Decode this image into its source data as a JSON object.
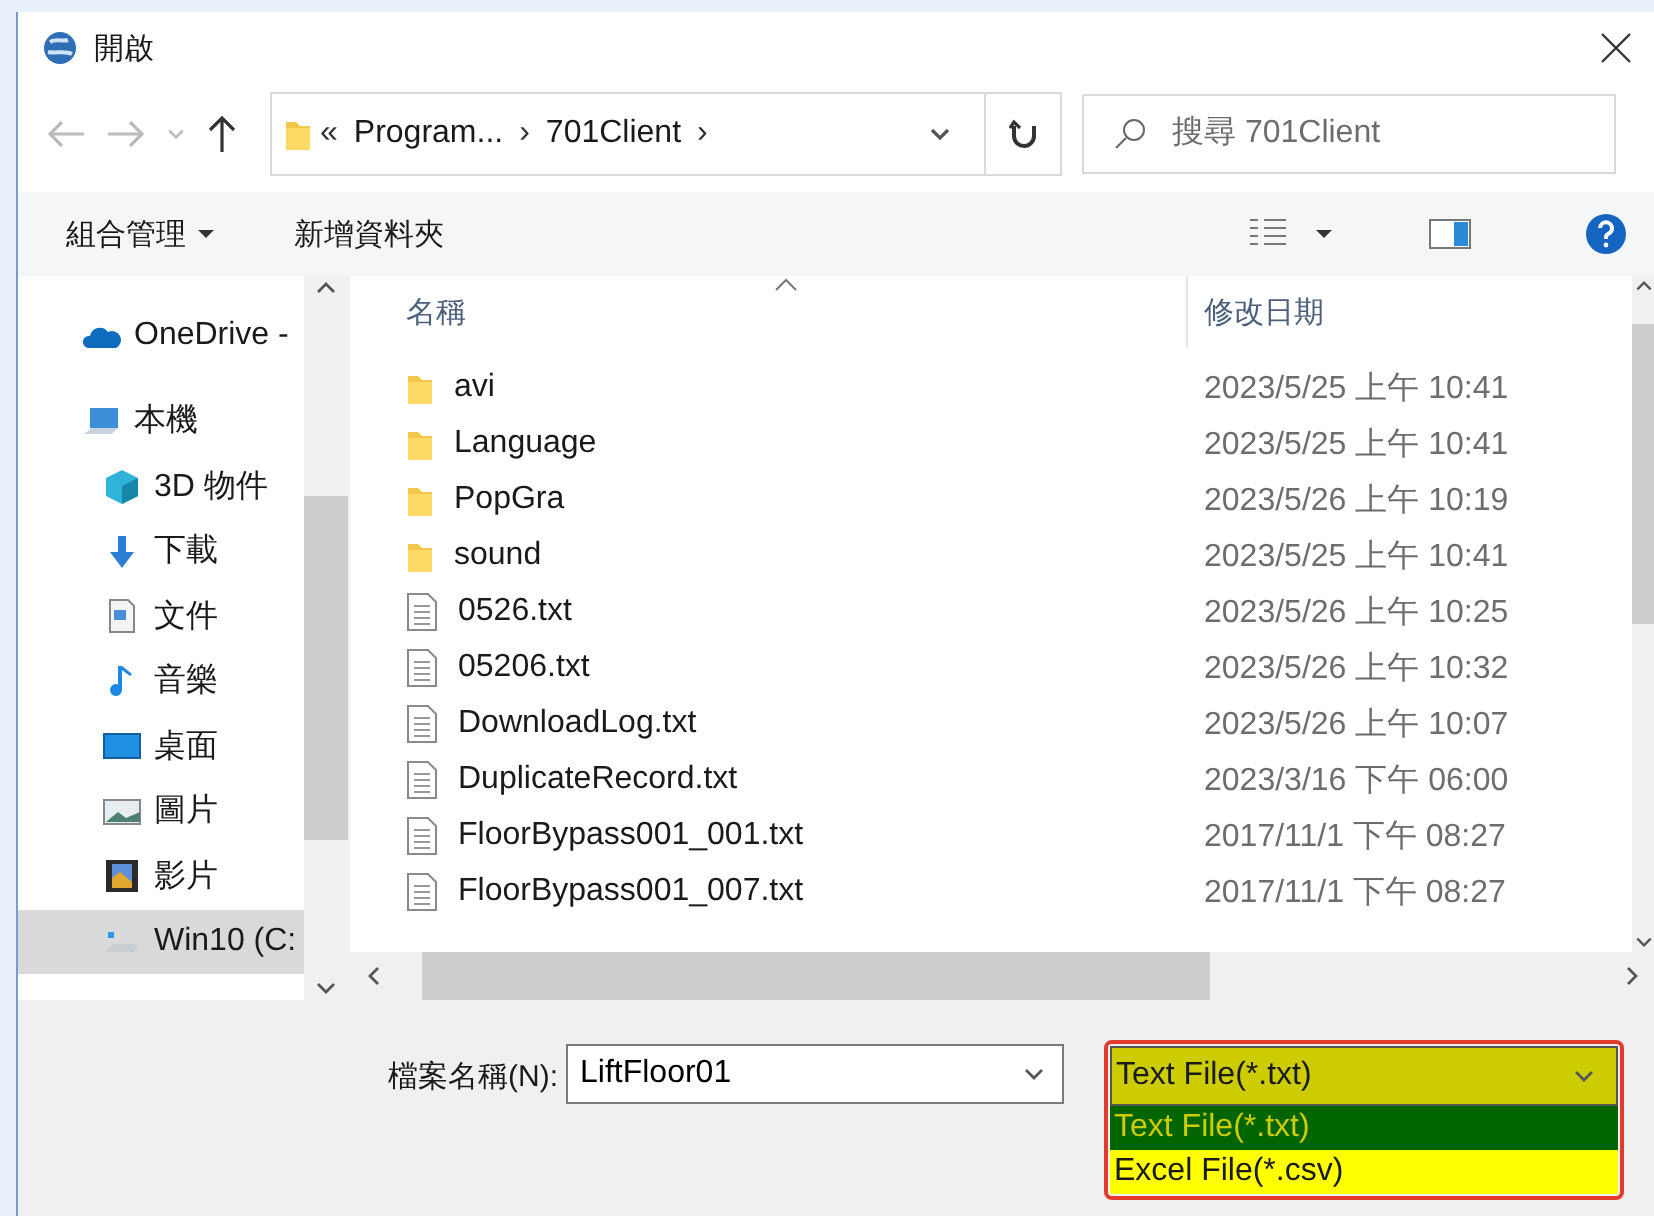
{
  "window": {
    "title": "開啟"
  },
  "address": {
    "overflow": "«",
    "segments": [
      "Program...",
      "701Client"
    ],
    "separator": "›"
  },
  "search": {
    "placeholder": "搜尋 701Client"
  },
  "toolbar": {
    "organize": "組合管理",
    "new_folder": "新增資料夾"
  },
  "sidebar": {
    "items": [
      {
        "label": "OneDrive -",
        "kind": "cloud",
        "selected": false
      },
      {
        "label": "本機",
        "kind": "computer",
        "selected": false,
        "children": [
          {
            "label": "3D 物件",
            "kind": "cube",
            "selected": false
          },
          {
            "label": "下載",
            "kind": "download",
            "selected": false
          },
          {
            "label": "文件",
            "kind": "document",
            "selected": false
          },
          {
            "label": "音樂",
            "kind": "music",
            "selected": false
          },
          {
            "label": "桌面",
            "kind": "desktop",
            "selected": false
          },
          {
            "label": "圖片",
            "kind": "picture",
            "selected": false
          },
          {
            "label": "影片",
            "kind": "video",
            "selected": false
          },
          {
            "label": "Win10 (C:",
            "kind": "drive",
            "selected": true
          }
        ]
      }
    ]
  },
  "table": {
    "columns": [
      "名稱",
      "修改日期"
    ],
    "rows": [
      {
        "name": "avi",
        "modified": "2023/5/25 上午 10:41",
        "kind": "folder"
      },
      {
        "name": "Language",
        "modified": "2023/5/25 上午 10:41",
        "kind": "folder"
      },
      {
        "name": "PopGra",
        "modified": "2023/5/26 上午 10:19",
        "kind": "folder"
      },
      {
        "name": "sound",
        "modified": "2023/5/25 上午 10:41",
        "kind": "folder"
      },
      {
        "name": "0526.txt",
        "modified": "2023/5/26 上午 10:25",
        "kind": "file"
      },
      {
        "name": "05206.txt",
        "modified": "2023/5/26 上午 10:32",
        "kind": "file"
      },
      {
        "name": "DownloadLog.txt",
        "modified": "2023/5/26 上午 10:07",
        "kind": "file"
      },
      {
        "name": "DuplicateRecord.txt",
        "modified": "2023/3/16 下午 06:00",
        "kind": "file"
      },
      {
        "name": "FloorBypass001_001.txt",
        "modified": "2017/11/1 下午 08:27",
        "kind": "file"
      },
      {
        "name": "FloorBypass001_007.txt",
        "modified": "2017/11/1 下午 08:27",
        "kind": "file"
      }
    ]
  },
  "filename": {
    "label": "檔案名稱(N):",
    "value": "LiftFloor01"
  },
  "filetype": {
    "value": "Text File(*.txt)",
    "options": [
      {
        "label": "Text File(*.txt)",
        "selected": true
      },
      {
        "label": "Excel File(*.csv)",
        "selected": false
      }
    ]
  }
}
